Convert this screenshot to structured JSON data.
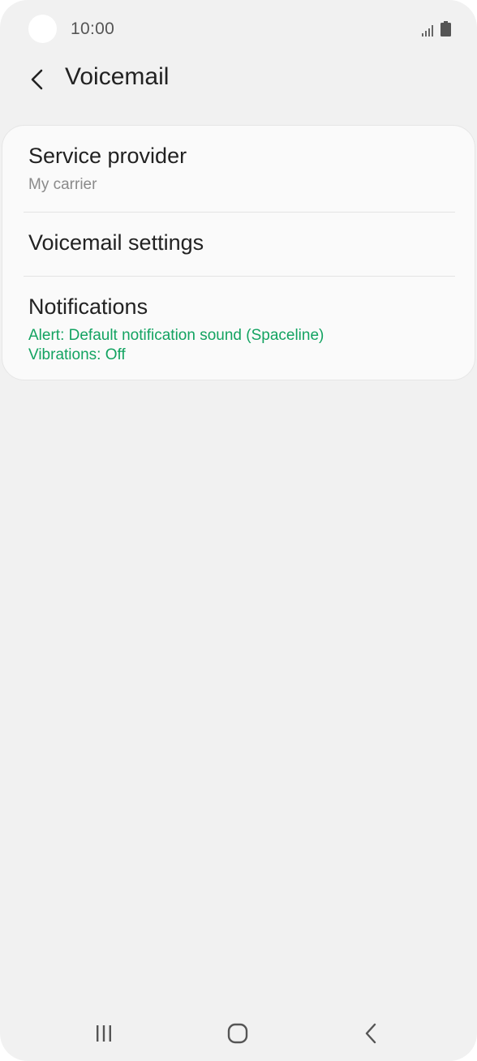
{
  "status_bar": {
    "time": "10:00",
    "icons": [
      "signal-icon",
      "battery-icon"
    ]
  },
  "header": {
    "back_icon": "chevron-left-icon",
    "title": "Voicemail"
  },
  "settings": {
    "items": [
      {
        "title": "Service provider",
        "subtitle": "My carrier"
      },
      {
        "title": "Voicemail settings"
      },
      {
        "title": "Notifications",
        "subtitle_lines": [
          "Alert: Default notification sound (Spaceline)",
          "Vibrations: Off"
        ]
      }
    ]
  },
  "nav_bar": {
    "icons": [
      "recent-apps-icon",
      "home-icon",
      "back-icon"
    ]
  },
  "colors": {
    "background": "#f1f1f1",
    "card": "#fafafa",
    "accent_green": "#13a361",
    "secondary_text": "#8a8a8a"
  }
}
